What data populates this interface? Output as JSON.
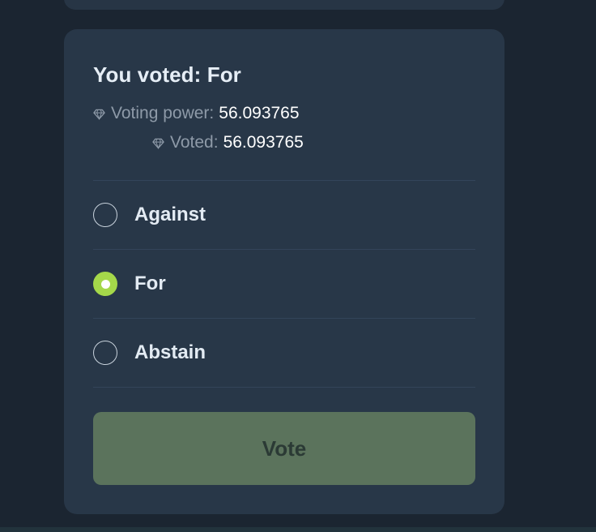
{
  "vote_card": {
    "title": "You voted: For",
    "voting_power": {
      "label": "Voting power:",
      "value": "56.093765",
      "icon": "diamond-icon"
    },
    "voted": {
      "label": "Voted:",
      "value": "56.093765",
      "icon": "diamond-icon"
    },
    "options": [
      {
        "label": "Against",
        "selected": false
      },
      {
        "label": "For",
        "selected": true
      },
      {
        "label": "Abstain",
        "selected": false
      }
    ],
    "vote_button_label": "Vote"
  },
  "colors": {
    "background": "#1b2531",
    "card": "#283748",
    "accent_selected": "#a5d84a",
    "vote_button": "#5b735c"
  }
}
